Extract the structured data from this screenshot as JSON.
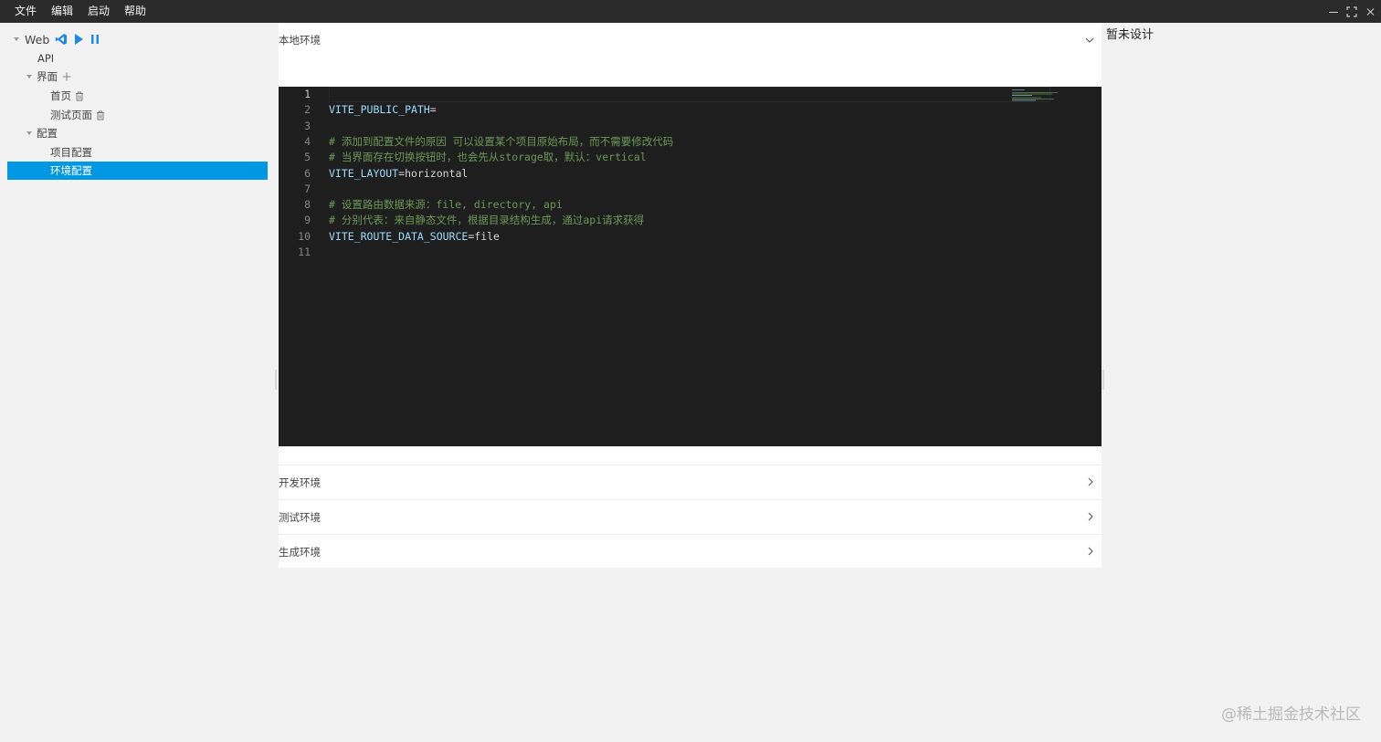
{
  "menu": {
    "items": [
      "文件",
      "编辑",
      "启动",
      "帮助"
    ]
  },
  "sidebar": {
    "root_label": "Web",
    "api_label": "API",
    "ui_group_label": "界面",
    "page_home": "首页",
    "page_test": "测试页面",
    "config_group_label": "配置",
    "project_config": "项目配置",
    "env_config": "环境配置"
  },
  "env_panels": {
    "local": "本地环境",
    "dev": "开发环境",
    "test": "测试环境",
    "prod": "生成环境"
  },
  "editor": {
    "lines": [
      {
        "num": "1",
        "key": "",
        "eq": "",
        "val": "",
        "comment": ""
      },
      {
        "num": "2",
        "key": "VITE_PUBLIC_PATH",
        "eq": "=",
        "val": "",
        "comment": ""
      },
      {
        "num": "3",
        "key": "",
        "eq": "",
        "val": "",
        "comment": ""
      },
      {
        "num": "4",
        "key": "",
        "eq": "",
        "val": "",
        "comment": "# 添加到配置文件的原因 可以设置某个项目原始布局，而不需要修改代码"
      },
      {
        "num": "5",
        "key": "",
        "eq": "",
        "val": "",
        "comment": "# 当界面存在切换按钮时，也会先从storage取，默认：vertical"
      },
      {
        "num": "6",
        "key": "VITE_LAYOUT",
        "eq": "=",
        "val": "horizontal",
        "comment": ""
      },
      {
        "num": "7",
        "key": "",
        "eq": "",
        "val": "",
        "comment": ""
      },
      {
        "num": "8",
        "key": "",
        "eq": "",
        "val": "",
        "comment": "# 设置路由数据来源：file, directory, api"
      },
      {
        "num": "9",
        "key": "",
        "eq": "",
        "val": "",
        "comment": "# 分别代表：来自静态文件，根据目录结构生成，通过api请求获得"
      },
      {
        "num": "10",
        "key": "VITE_ROUTE_DATA_SOURCE",
        "eq": "=",
        "val": "file",
        "comment": ""
      },
      {
        "num": "11",
        "key": "",
        "eq": "",
        "val": "",
        "comment": ""
      }
    ]
  },
  "right_panel": {
    "text": "暂未设计"
  },
  "watermark": "@稀土掘金技术社区",
  "colors": {
    "accent": "#0098e3",
    "editor_bg": "#1e1e1e",
    "comment": "#6a9955",
    "key": "#9cdcfe",
    "titlebar": "#2b2b2b"
  },
  "icons": [
    "vscode-icon",
    "play-icon",
    "pause-icon",
    "plus-icon",
    "trash-icon",
    "chevron-down-icon",
    "chevron-right-icon"
  ]
}
